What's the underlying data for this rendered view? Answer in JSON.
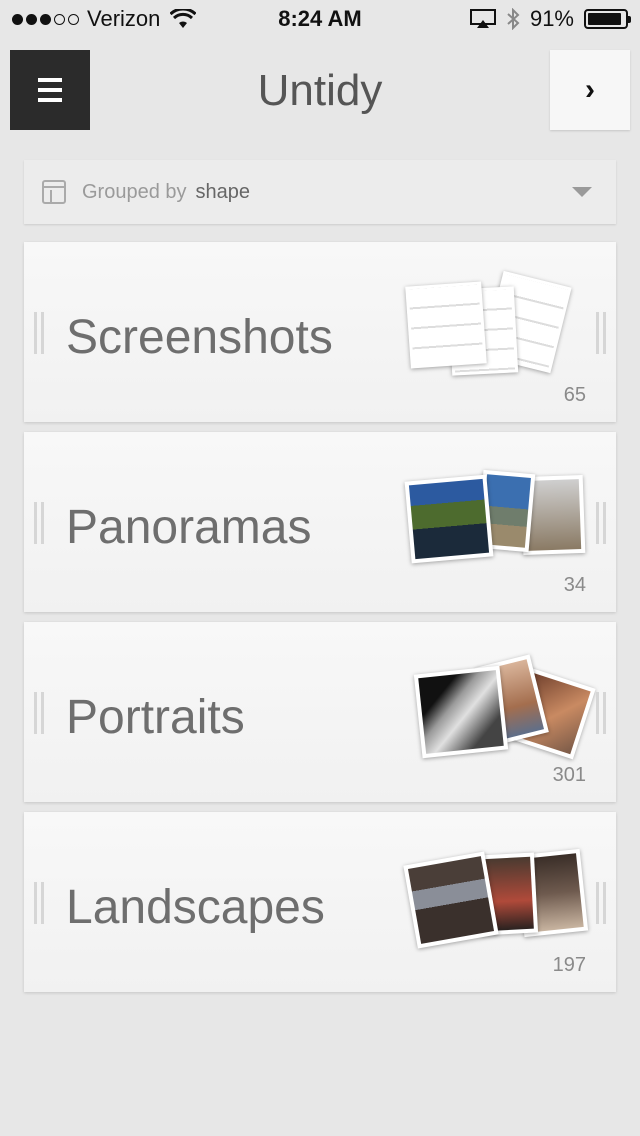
{
  "status_bar": {
    "carrier": "Verizon",
    "time": "8:24 AM",
    "battery": "91%",
    "battery_level": 0.91
  },
  "header": {
    "title": "Untidy",
    "menu_icon": "hamburger-menu-icon",
    "next_icon": "chevron-right-icon",
    "next_glyph": "›"
  },
  "group_by": {
    "label": "Grouped by",
    "value": "shape"
  },
  "groups": [
    {
      "label": "Screenshots",
      "count": "65"
    },
    {
      "label": "Panoramas",
      "count": "34"
    },
    {
      "label": "Portraits",
      "count": "301"
    },
    {
      "label": "Landscapes",
      "count": "197"
    }
  ]
}
